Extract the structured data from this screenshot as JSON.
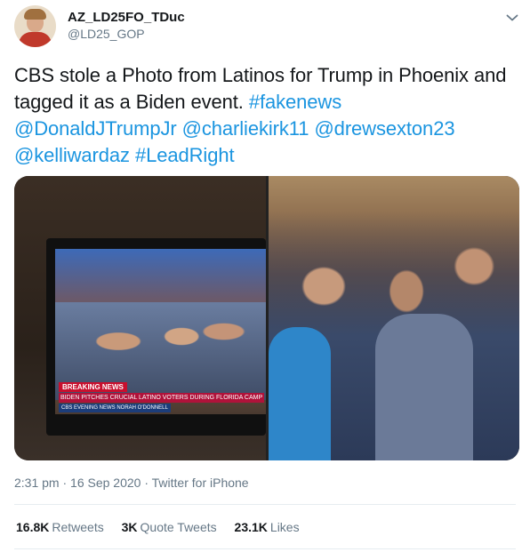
{
  "author": {
    "display_name": "AZ_LD25FO_TDuc",
    "handle": "@LD25_GOP",
    "avatar_icon": "avatar-photo"
  },
  "menu_icon": "chevron-down-icon",
  "tweet": {
    "text_plain": "CBS stole a Photo from Latinos for Trump in Phoenix and tagged it as a Biden event.",
    "hashtag_fakenews": "#fakenews",
    "mention_1": "@DonaldJTrumpJr",
    "mention_2": "@charliekirk11",
    "mention_3": "@drewsexton23",
    "mention_4": "@kelliwardaz",
    "hashtag_leadright": "#LeadRight"
  },
  "media": {
    "left_image": {
      "breaking_label": "BREAKING NEWS",
      "headline": "BIDEN PITCHES CRUCIAL LATINO VOTERS DURING FLORIDA CAMP",
      "show": "CBS EVENING NEWS  NORAH O'DONNELL"
    }
  },
  "meta": {
    "time": "2:31 pm",
    "date": "16 Sep 2020",
    "source": "Twitter for iPhone",
    "separator": "·"
  },
  "stats": {
    "retweets_count": "16.8K",
    "retweets_label": "Retweets",
    "quotes_count": "3K",
    "quotes_label": "Quote Tweets",
    "likes_count": "23.1K",
    "likes_label": "Likes"
  },
  "colors": {
    "link": "#1b95e0",
    "text": "#14171a",
    "secondary": "#657786",
    "divider": "#e6ecf0"
  }
}
